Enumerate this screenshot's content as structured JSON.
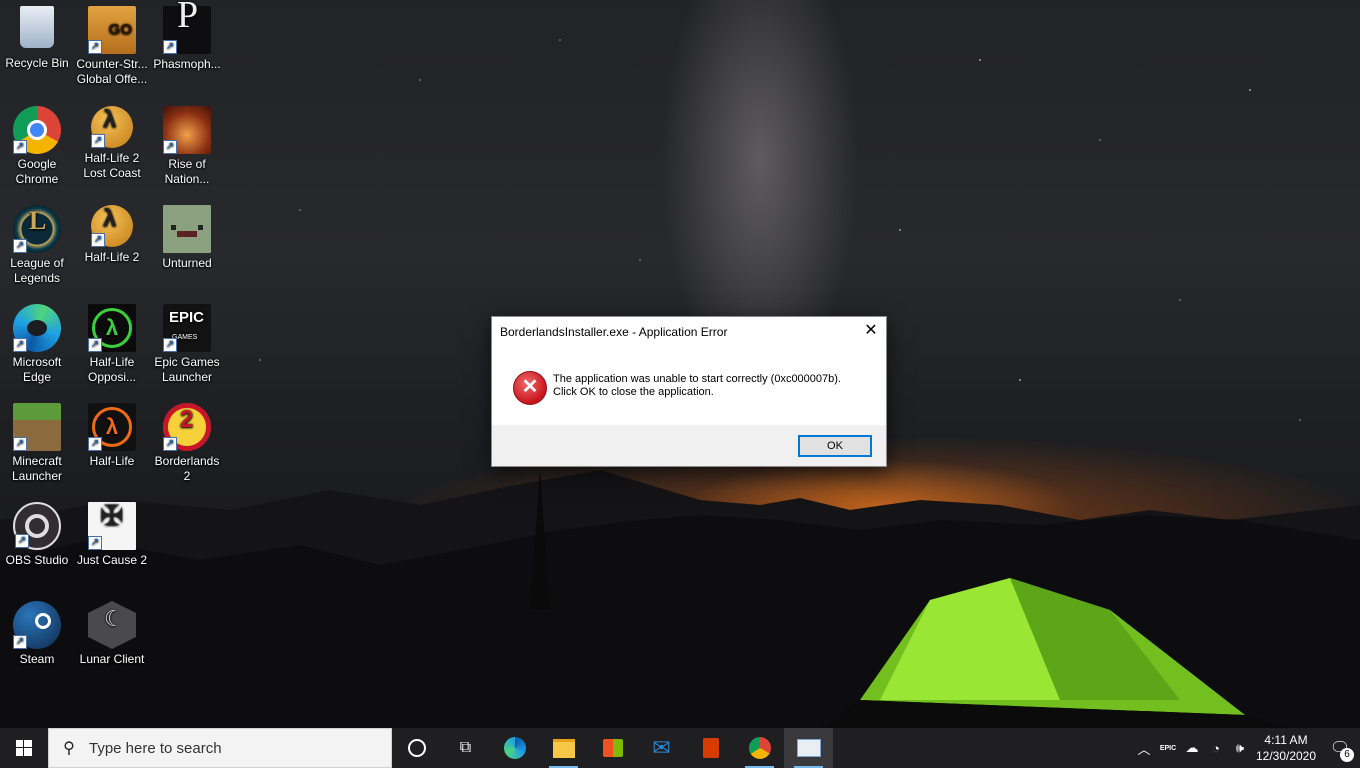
{
  "desktop_icons": [
    {
      "label": "Recycle Bin",
      "icon": "recycle-bin-icon",
      "shortcut": false
    },
    {
      "label": "Counter-Str...\nGlobal Offe...",
      "icon": "csgo-icon",
      "shortcut": true
    },
    {
      "label": "Phasmoph...",
      "icon": "phasmophobia-icon",
      "shortcut": true
    },
    {
      "label": "Google\nChrome",
      "icon": "chrome-icon",
      "shortcut": true
    },
    {
      "label": "Half-Life 2\nLost Coast",
      "icon": "half-life-2-icon",
      "shortcut": true
    },
    {
      "label": "Rise of\nNation...",
      "icon": "rise-of-nations-icon",
      "shortcut": true
    },
    {
      "label": "League of\nLegends",
      "icon": "league-of-legends-icon",
      "shortcut": true
    },
    {
      "label": "Half-Life 2",
      "icon": "half-life-2-icon",
      "shortcut": true
    },
    {
      "label": "Unturned",
      "icon": "unturned-icon",
      "shortcut": false
    },
    {
      "label": "Microsoft\nEdge",
      "icon": "edge-icon",
      "shortcut": true
    },
    {
      "label": "Half-Life\nOpposi...",
      "icon": "half-life-opposing-force-icon",
      "shortcut": true
    },
    {
      "label": "Epic Games\nLauncher",
      "icon": "epic-games-icon",
      "shortcut": true
    },
    {
      "label": "Minecraft\nLauncher",
      "icon": "minecraft-icon",
      "shortcut": true
    },
    {
      "label": "Half-Life",
      "icon": "half-life-icon",
      "shortcut": true
    },
    {
      "label": "Borderlands\n2",
      "icon": "borderlands-2-icon",
      "shortcut": true
    },
    {
      "label": "OBS Studio",
      "icon": "obs-icon",
      "shortcut": true
    },
    {
      "label": "Just Cause 2",
      "icon": "just-cause-2-icon",
      "shortcut": true
    },
    {
      "label": "Steam",
      "icon": "steam-icon",
      "shortcut": true
    },
    {
      "label": "Lunar Client",
      "icon": "lunar-client-icon",
      "shortcut": true
    }
  ],
  "dialog": {
    "title": "BorderlandsInstaller.exe - Application Error",
    "message_line1": "The application was unable to start correctly (0xc000007b).",
    "message_line2": "Click OK to close the application.",
    "ok_label": "OK",
    "close_glyph": "✕"
  },
  "taskbar": {
    "search_placeholder": "Type here to search",
    "pinned": [
      "cortana-icon",
      "task-view-icon",
      "edge-icon",
      "file-explorer-icon",
      "microsoft-store-icon",
      "mail-icon",
      "office-icon",
      "chrome-icon",
      "running-app-icon"
    ],
    "tray": {
      "time": "4:11 AM",
      "date": "12/30/2020",
      "notification_count": "6",
      "epic_label": "EPIC"
    }
  },
  "colors": {
    "accent": "#0078d7",
    "taskbar": "#1f1f21",
    "error_red": "#c8161d",
    "tent_green": "#7ed321"
  }
}
